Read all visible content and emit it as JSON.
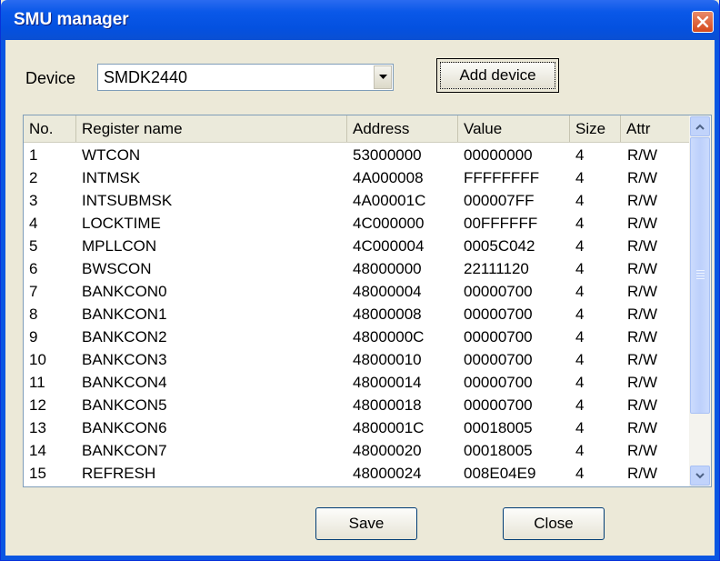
{
  "window": {
    "title": "SMU manager"
  },
  "device": {
    "label": "Device",
    "selected": "SMDK2440",
    "add_label": "Add device"
  },
  "table": {
    "columns": [
      "No.",
      "Register name",
      "Address",
      "Value",
      "Size",
      "Attr"
    ],
    "rows": [
      [
        "1",
        "WTCON",
        "53000000",
        "00000000",
        "4",
        "R/W"
      ],
      [
        "2",
        "INTMSK",
        "4A000008",
        "FFFFFFFF",
        "4",
        "R/W"
      ],
      [
        "3",
        "INTSUBMSK",
        "4A00001C",
        "000007FF",
        "4",
        "R/W"
      ],
      [
        "4",
        "LOCKTIME",
        "4C000000",
        "00FFFFFF",
        "4",
        "R/W"
      ],
      [
        "5",
        "MPLLCON",
        "4C000004",
        "0005C042",
        "4",
        "R/W"
      ],
      [
        "6",
        "BWSCON",
        "48000000",
        "22111120",
        "4",
        "R/W"
      ],
      [
        "7",
        "BANKCON0",
        "48000004",
        "00000700",
        "4",
        "R/W"
      ],
      [
        "8",
        "BANKCON1",
        "48000008",
        "00000700",
        "4",
        "R/W"
      ],
      [
        "9",
        "BANKCON2",
        "4800000C",
        "00000700",
        "4",
        "R/W"
      ],
      [
        "10",
        "BANKCON3",
        "48000010",
        "00000700",
        "4",
        "R/W"
      ],
      [
        "11",
        "BANKCON4",
        "48000014",
        "00000700",
        "4",
        "R/W"
      ],
      [
        "12",
        "BANKCON5",
        "48000018",
        "00000700",
        "4",
        "R/W"
      ],
      [
        "13",
        "BANKCON6",
        "4800001C",
        "00018005",
        "4",
        "R/W"
      ],
      [
        "14",
        "BANKCON7",
        "48000020",
        "00018005",
        "4",
        "R/W"
      ],
      [
        "15",
        "REFRESH",
        "48000024",
        "008E04E9",
        "4",
        "R/W"
      ]
    ]
  },
  "buttons": {
    "save": "Save",
    "close": "Close"
  },
  "colors": {
    "titlebar": "#0a58e8",
    "close": "#d6491c",
    "dialog": "#ece9d8"
  }
}
